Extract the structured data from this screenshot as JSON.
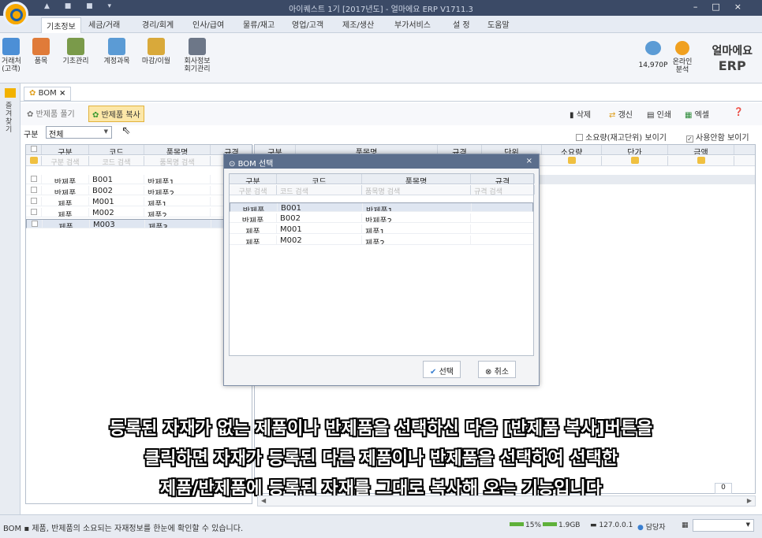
{
  "window": {
    "title": "아이퀘스트 1기 [2017년도] - 얼마에요 ERP V1711.3",
    "controls": [
      "–",
      "□",
      "×"
    ]
  },
  "menu_tabs": [
    "기초정보",
    "세금/거래",
    "경리/회계",
    "인사/급여",
    "물류/재고",
    "영업/고객",
    "제조/생산",
    "부가서비스",
    "설 정",
    "도움말"
  ],
  "ribbon": {
    "items": [
      "거래처\n(고객)",
      "품목",
      "기초관리",
      "계정과목",
      "마감/이월",
      "회사정보\n회기관리"
    ],
    "points": "14,970P",
    "online": "온라인\n분석",
    "brand_line1": "얼마에요",
    "brand_line2": "ERP"
  },
  "sidebar_label": "즐겨찾기",
  "doc_tab": "BOM",
  "doc_tab_close": "×",
  "toolbar": {
    "left": [
      "반제품 풀기",
      "반제품 복사"
    ],
    "right": [
      "삭제",
      "갱신",
      "인쇄",
      "엑셀"
    ]
  },
  "filter": {
    "label": "구분",
    "value": "전체"
  },
  "options": {
    "opt1": "소요량(재고단위) 보이기",
    "opt2": "사용안함 보이기"
  },
  "left_grid": {
    "headers": [
      "구분",
      "코드",
      "품목명",
      "규격"
    ],
    "search": [
      "구분 검색",
      "코드 검색",
      "품목명 검색",
      "규격"
    ],
    "rows": [
      [
        "반제품",
        "B001",
        "반제품1"
      ],
      [
        "반제품",
        "B002",
        "반제품2"
      ],
      [
        "제품",
        "M001",
        "제품1"
      ],
      [
        "제품",
        "M002",
        "제품2"
      ],
      [
        "제품",
        "M003",
        "제품3"
      ]
    ]
  },
  "right_grid": {
    "headers": [
      "구분",
      "품목명",
      "규격",
      "단위",
      "소요량",
      "단가",
      "금액"
    ]
  },
  "modal": {
    "title": "BOM 선택",
    "headers": [
      "구분",
      "코드",
      "품목명",
      "규격"
    ],
    "search": [
      "구분 검색",
      "코드 검색",
      "품목명 검색",
      "규격 검색"
    ],
    "rows": [
      [
        "반제품",
        "B001",
        "반제품1"
      ],
      [
        "반제품",
        "B002",
        "반제품2"
      ],
      [
        "제품",
        "M001",
        "제품1"
      ],
      [
        "제품",
        "M002",
        "제품2"
      ]
    ],
    "ok": "선택",
    "cancel": "취소"
  },
  "subtitle": [
    "등록된 자재가 없는 제품이나 반제품을 선택하신 다음 [반제품 복사]버튼을",
    "클릭하면 자재가 등록된 다른 제품이나 반제품을 선택하여 선택한",
    "제품/반제품에 등록된 자재를 그대로 복사해 오는 기능입니다"
  ],
  "total": "0",
  "status": {
    "message": "BOM  ▪  제품, 반제품의 소요되는 자재정보를 한눈에 확인할 수 있습니다.",
    "cpu": "15%",
    "mem": "1.9GB",
    "ip": "127.0.0.1",
    "user": "담당자"
  }
}
